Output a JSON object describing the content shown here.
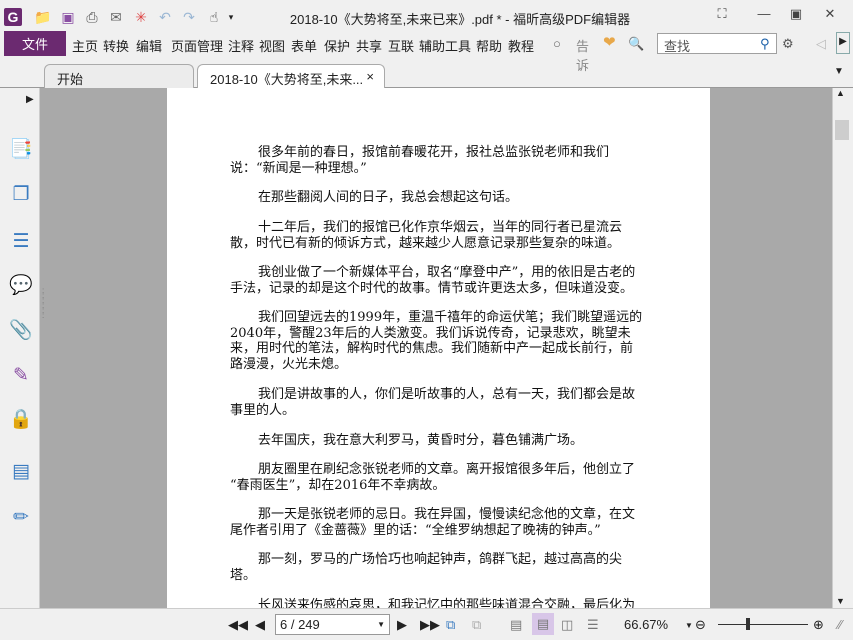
{
  "app": {
    "title": "2018-10《大势将至,未来已来》.pdf * - 福昕高级PDF编辑器"
  },
  "menu": {
    "file": "文件",
    "items": [
      "主页",
      "转换",
      "编辑",
      "页面管理",
      "注释",
      "视图",
      "表单",
      "保护",
      "共享",
      "互联",
      "辅助工具",
      "帮助",
      "教程"
    ],
    "tell": "告诉",
    "search_placeholder": "查找"
  },
  "tabs": [
    {
      "label": "开始"
    },
    {
      "label": "2018-10《大势将至,未来...",
      "close": "×"
    }
  ],
  "document": {
    "paragraphs": [
      [
        "很多年前的春日，报馆前春暖花开，报社总监张锐老师和我们",
        "说：“新闻是一种理想。”"
      ],
      [
        "在那些翻阅人间的日子，我总会想起这句话。"
      ],
      [
        "十二年后，我们的报馆已化作京华烟云，当年的同行者已星流云",
        "散，时代已有新的倾诉方式，越来越少人愿意记录那些复杂的味道。"
      ],
      [
        "我创业做了一个新媒体平台，取名“摩登中产”，用的依旧是古老的",
        "手法，记录的却是这个时代的故事。情节或许更迭太多，但味道没变。"
      ],
      [
        "我们回望远去的1999年，重温千禧年的命运伏笔；我们眺望遥远的",
        "2040年，警醒23年后的人类激变。我们诉说传奇，记录悲欢，眺望未",
        "来，用时代的笔法，解构时代的焦虑。我们随新中产一起成长前行，前",
        "路漫漫，火光未熄。"
      ],
      [
        "我们是讲故事的人，你们是听故事的人，总有一天，我们都会是故",
        "事里的人。"
      ],
      [
        "去年国庆，我在意大利罗马，黄昏时分，暮色铺满广场。"
      ],
      [
        "朋友圈里在刷纪念张锐老师的文章。离开报馆很多年后，他创立了",
        "“春雨医生”，却在2016年不幸病故。"
      ],
      [
        "那一天是张锐老师的忌日。我在异国，慢慢读纪念他的文章，在文",
        "尾作者引用了《金蔷薇》里的话：“全维罗纳想起了晚祷的钟声。”"
      ],
      [
        "那一刻，罗马的广场恰巧也响起钟声，鸽群飞起，越过高高的尖",
        "塔。"
      ],
      [
        "长风送来伤感的哀思，和我记忆中的那些味道混合交融，最后化为"
      ]
    ]
  },
  "status": {
    "page": "6 / 249",
    "zoom": "66.67%"
  },
  "colors": {
    "accent": "#6b2a70"
  }
}
